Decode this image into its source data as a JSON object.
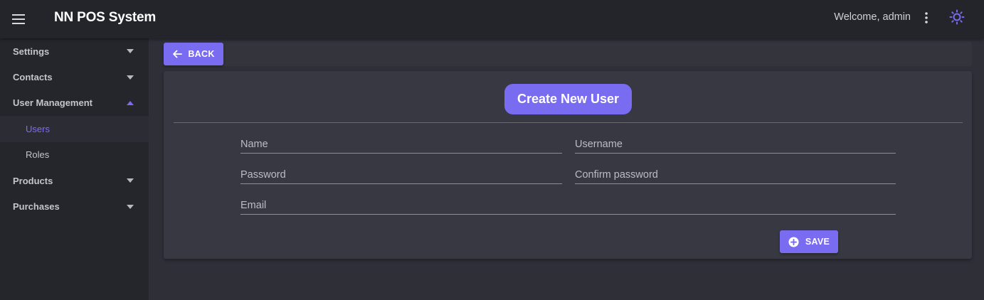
{
  "app": {
    "title": "NN POS System",
    "welcome": "Welcome, admin"
  },
  "icons": {
    "menu": "hamburger-menu-icon",
    "kebab": "more-vert-icon",
    "theme": "sun-icon",
    "back": "arrow-left-icon",
    "save": "plus-circle-icon",
    "expand": "caret-down-icon",
    "collapse": "caret-up-icon"
  },
  "colors": {
    "accent": "#7a6cf0",
    "appbar": "#24242b",
    "sidebar": "#25252c",
    "card": "#383842"
  },
  "sidebar": {
    "items": [
      {
        "label": "Settings",
        "state": "collapsed"
      },
      {
        "label": "Contacts",
        "state": "collapsed"
      },
      {
        "label": "User Management",
        "state": "expanded"
      },
      {
        "label": "Users",
        "state": "active-sub"
      },
      {
        "label": "Roles",
        "state": "sub"
      },
      {
        "label": "Products",
        "state": "collapsed"
      },
      {
        "label": "Purchases",
        "state": "collapsed"
      }
    ]
  },
  "toolbar": {
    "back_label": "BACK"
  },
  "form": {
    "title": "Create New User",
    "fields": {
      "name": {
        "placeholder": "Name",
        "value": ""
      },
      "username": {
        "placeholder": "Username",
        "value": ""
      },
      "password": {
        "placeholder": "Password",
        "value": ""
      },
      "confirm_password": {
        "placeholder": "Confirm password",
        "value": ""
      },
      "email": {
        "placeholder": "Email",
        "value": ""
      }
    },
    "save_label": "SAVE"
  }
}
